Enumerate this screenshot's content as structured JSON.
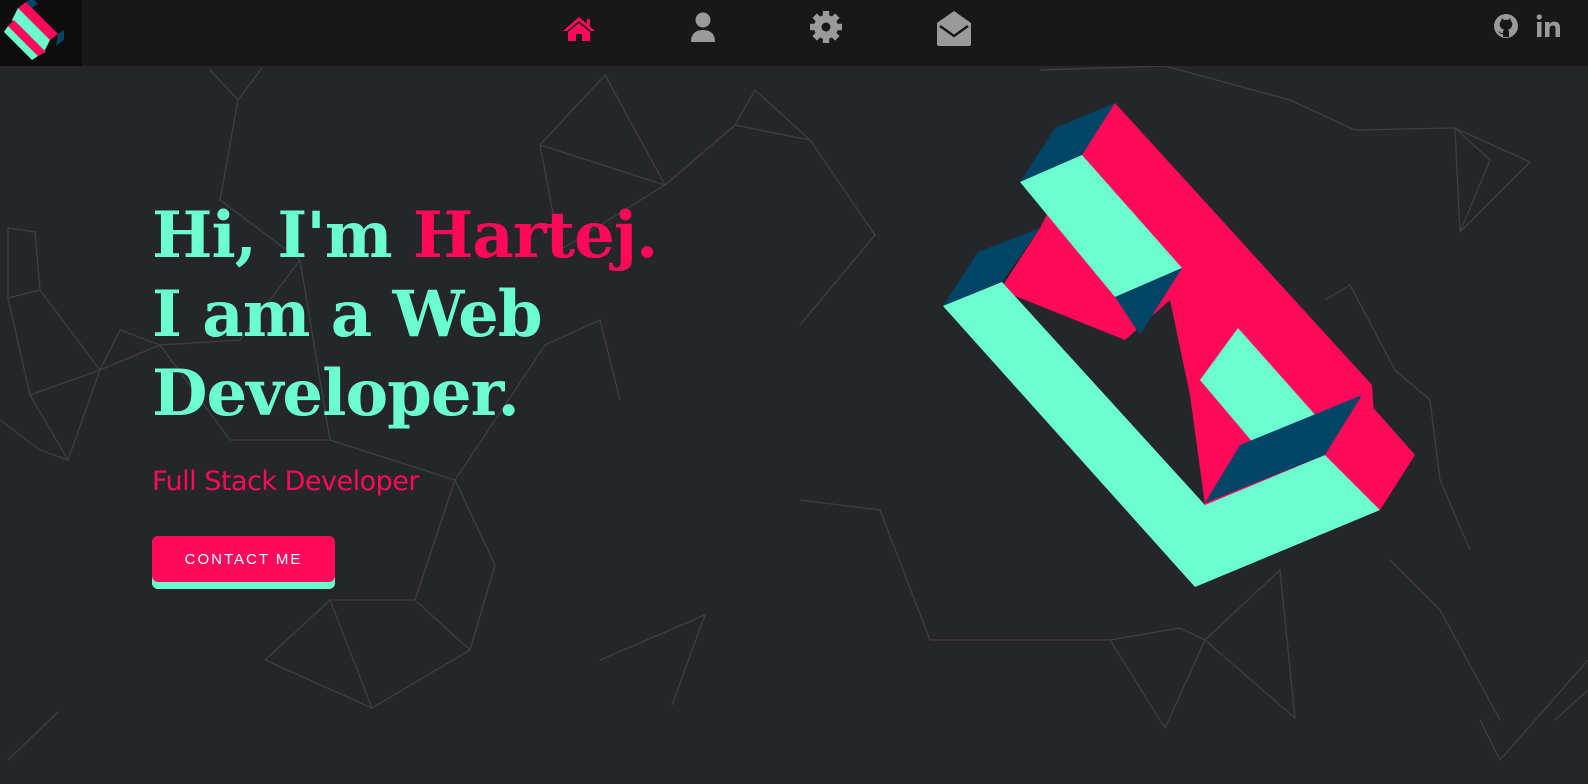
{
  "colors": {
    "accent": "#ff0a5a",
    "mint": "#6bffcf",
    "navy": "#004466",
    "nav_icon": "#9a9a9a",
    "background": "#252629",
    "topbar": "#181819"
  },
  "nav": {
    "items": [
      {
        "icon": "home-icon",
        "active": true
      },
      {
        "icon": "user-icon",
        "active": false
      },
      {
        "icon": "gear-icon",
        "active": false
      },
      {
        "icon": "envelope-open-icon",
        "active": false
      }
    ],
    "social": [
      "github-icon",
      "linkedin-icon"
    ]
  },
  "hero": {
    "greeting": "Hi, I'm ",
    "name": "Hartej.",
    "line2": "I am a Web",
    "line3": "Developer.",
    "subtitle": "Full Stack Developer",
    "cta_label": "CONTACT ME"
  }
}
